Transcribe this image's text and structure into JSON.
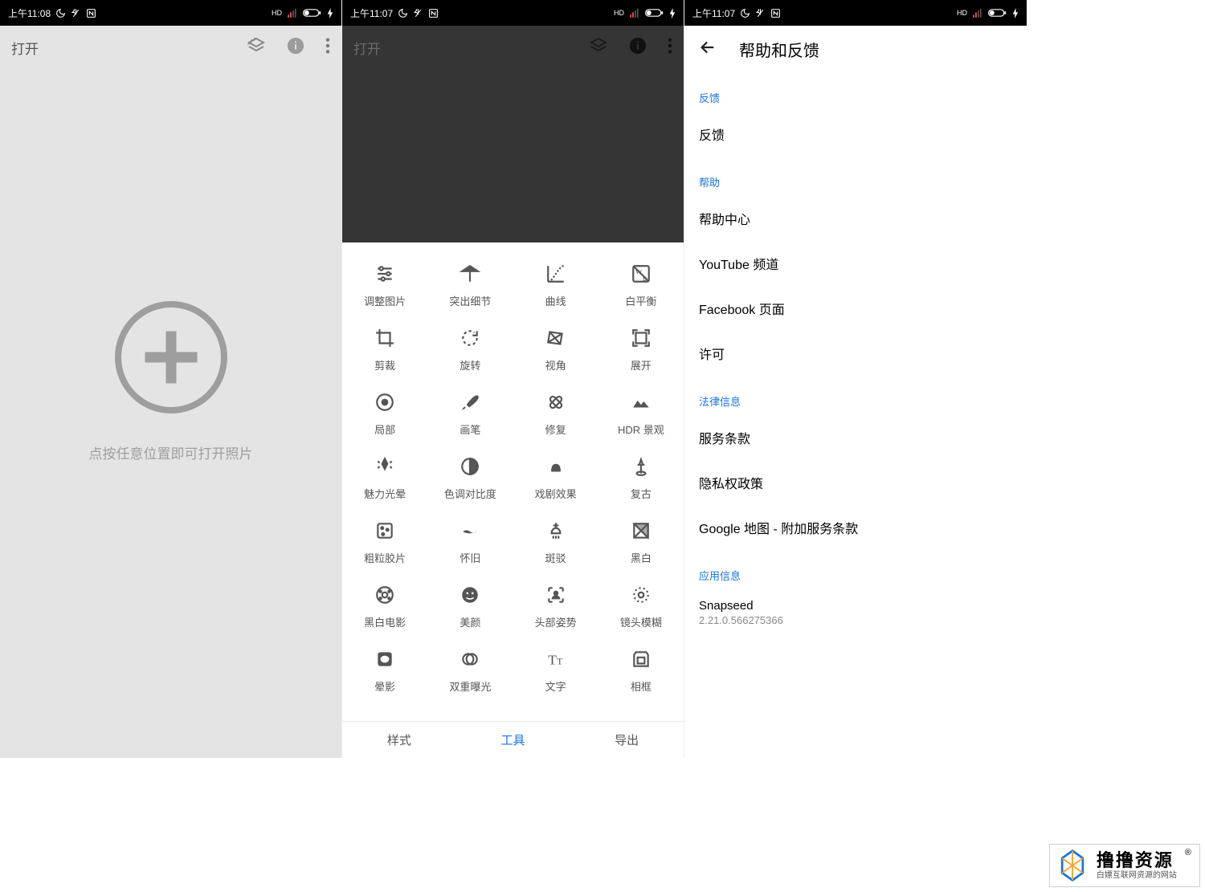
{
  "status": {
    "time_s1": "上午11:08",
    "time_s2": "上午11:07",
    "time_s3": "上午11:07",
    "hd": "HD"
  },
  "screen1": {
    "open_label": "打开",
    "hint": "点按任意位置即可打开照片"
  },
  "screen2": {
    "open_label": "打开",
    "tools": [
      [
        {
          "name": "tune-icon",
          "label": "调整图片"
        },
        {
          "name": "details-icon",
          "label": "突出细节"
        },
        {
          "name": "curves-icon",
          "label": "曲线"
        },
        {
          "name": "white-balance-icon",
          "label": "白平衡"
        }
      ],
      [
        {
          "name": "crop-icon",
          "label": "剪裁"
        },
        {
          "name": "rotate-icon",
          "label": "旋转"
        },
        {
          "name": "perspective-icon",
          "label": "视角"
        },
        {
          "name": "expand-icon",
          "label": "展开"
        }
      ],
      [
        {
          "name": "selective-icon",
          "label": "局部"
        },
        {
          "name": "brush-icon",
          "label": "画笔"
        },
        {
          "name": "healing-icon",
          "label": "修复"
        },
        {
          "name": "hdr-icon",
          "label": "HDR 景观"
        }
      ],
      [
        {
          "name": "glamour-icon",
          "label": "魅力光晕"
        },
        {
          "name": "tonal-icon",
          "label": "色调对比度"
        },
        {
          "name": "drama-icon",
          "label": "戏剧效果"
        },
        {
          "name": "vintage-icon",
          "label": "复古"
        }
      ],
      [
        {
          "name": "grainy-icon",
          "label": "粗粒胶片"
        },
        {
          "name": "retrolux-icon",
          "label": "怀旧"
        },
        {
          "name": "grunge-icon",
          "label": "斑驳"
        },
        {
          "name": "bw-icon",
          "label": "黑白"
        }
      ],
      [
        {
          "name": "noir-icon",
          "label": "黑白电影"
        },
        {
          "name": "portrait-icon",
          "label": "美颜"
        },
        {
          "name": "headpose-icon",
          "label": "头部姿势"
        },
        {
          "name": "lensblur-icon",
          "label": "镜头模糊"
        }
      ],
      [
        {
          "name": "vignette-icon",
          "label": "晕影"
        },
        {
          "name": "double-exposure-icon",
          "label": "双重曝光"
        },
        {
          "name": "text-icon",
          "label": "文字"
        },
        {
          "name": "frames-icon",
          "label": "相框"
        }
      ]
    ],
    "tabs": {
      "styles": "样式",
      "tools": "工具",
      "export": "导出"
    }
  },
  "screen3": {
    "title": "帮助和反馈",
    "sections": [
      {
        "header": "反馈",
        "items": [
          "反馈"
        ]
      },
      {
        "header": "帮助",
        "items": [
          "帮助中心",
          "YouTube 频道",
          "Facebook 页面",
          "许可"
        ]
      },
      {
        "header": "法律信息",
        "items": [
          "服务条款",
          "隐私权政策",
          "Google 地图 - 附加服务条款"
        ]
      },
      {
        "header": "应用信息",
        "items": []
      }
    ],
    "app": {
      "name": "Snapseed",
      "version": "2.21.0.566275366"
    }
  },
  "watermark": {
    "main": "撸撸资源",
    "sub": "白嫖互联网资源的网站",
    "r": "®"
  }
}
